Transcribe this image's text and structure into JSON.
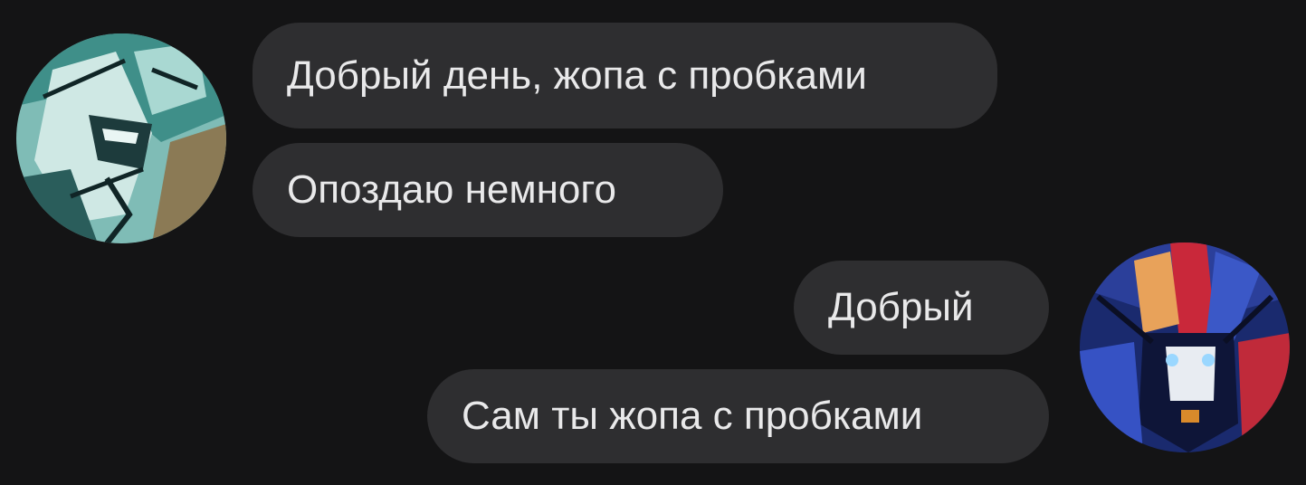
{
  "messages": [
    {
      "sender": "left",
      "text": "Добрый день, жопа с пробками"
    },
    {
      "sender": "left",
      "text": "Опоздаю немного"
    },
    {
      "sender": "right",
      "text": "Добрый"
    },
    {
      "sender": "right",
      "text": "Сам ты жопа с пробками"
    }
  ],
  "colors": {
    "background": "#141415",
    "bubble": "#2e2e30",
    "text": "#e9e9ea"
  }
}
